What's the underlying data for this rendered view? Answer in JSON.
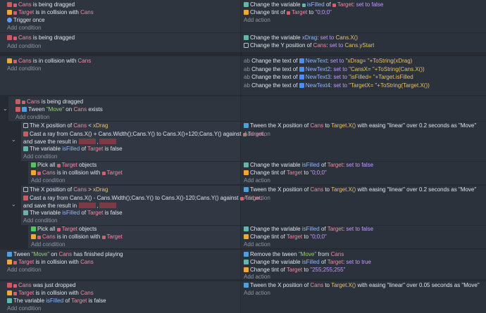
{
  "add_condition": "Add condition",
  "add_action": "Add action",
  "events": [
    {
      "conditions": [
        {
          "obj": "Cans",
          "text": "is being dragged"
        },
        {
          "obj": "Target",
          "text": "is in collision with",
          "obj2": "Cans"
        },
        {
          "text": "Trigger once"
        }
      ],
      "actions": [
        {
          "text": "Change the variable",
          "var": "isFilled",
          "of": "of",
          "obj": "Target",
          "value": "set to false"
        },
        {
          "text": "Change tint of",
          "obj": "Target",
          "to": "to",
          "value": "\"0;0;0\""
        }
      ]
    },
    {
      "conditions": [
        {
          "obj": "Cans",
          "text": "is being dragged"
        }
      ],
      "actions": [
        {
          "text": "Change the variable",
          "var": "xDrag",
          "value": "set to",
          "expr": "Cans.X()"
        },
        {
          "text": "Change the Y position of",
          "obj": "Cans",
          "value": "set to",
          "expr": "Cans.yStart"
        }
      ]
    },
    {
      "conditions": [
        {
          "obj": "Cans",
          "text": "is in collision with",
          "obj2": "Cans"
        }
      ],
      "actions": [
        {
          "text": "Change the text of",
          "obj": "NewText",
          "value": "set to",
          "expr": "\"xDrag= \"+ToString(xDrag)"
        },
        {
          "text": "Change the text of",
          "obj": "NewText2",
          "value": "set to",
          "expr": "\"CansX= \"+ToString(Cans.X())"
        },
        {
          "text": "Change the text of",
          "obj": "NewText3",
          "value": "set to",
          "expr": "\"isFilled= \"+Target.isFilled"
        },
        {
          "text": "Change the text of",
          "obj": "NewText4",
          "value": "set to",
          "expr": "\"TargetX= \"+ToString(Target.X())"
        }
      ]
    },
    {
      "conditions": [
        {
          "obj": "Cans",
          "text": "is being dragged"
        },
        {
          "pre": "Tween",
          "q": "\"Move\"",
          "mid": "on",
          "obj": "Cans",
          "text": "exists"
        }
      ]
    },
    {
      "conditions": [
        {
          "pre": "The X position of",
          "obj": "Cans",
          "op": "<",
          "val": "xDrag"
        },
        {
          "text": "Cast a ray from Cans.X() + Cans.Width();Cans.Y() to Cans.X()+120;Cans.Y() against",
          "obj": "Target,"
        },
        {
          "text": "and save the result in"
        },
        {
          "pre": "The variable",
          "var": "isFilled",
          "mid": "of",
          "obj": "Target",
          "val": "is false"
        }
      ],
      "actions": [
        {
          "text": "Tween the X position of",
          "obj": "Cans",
          "value": "to",
          "expr": "Target.X()",
          "rest": "with easing \"linear\" over 0.2 seconds as \"Move\""
        }
      ]
    },
    {
      "conditions": [
        {
          "text": "Pick all",
          "obj": "Target",
          "val": "objects"
        },
        {
          "obj": "Cans",
          "text": "is in collision with",
          "obj2": "Target"
        }
      ],
      "actions": [
        {
          "text": "Change the variable",
          "var": "isFilled",
          "of": "of",
          "obj": "Target",
          "value": "set to false"
        },
        {
          "text": "Change tint of",
          "obj": "Target",
          "to": "to",
          "value": "\"0;0;0\""
        }
      ]
    },
    {
      "conditions": [
        {
          "pre": "The X position of",
          "obj": "Cans",
          "op": ">",
          "val": "xDrag"
        },
        {
          "text": "Cast a ray from Cans.X() - Cans.Width();Cans.Y() to Cans.X()-120;Cans.Y() against",
          "obj": "Target,"
        },
        {
          "text": "and save the result in"
        },
        {
          "pre": "The variable",
          "var": "isFilled",
          "mid": "of",
          "obj": "Target",
          "val": "is false"
        }
      ],
      "actions": [
        {
          "text": "Tween the X position of",
          "obj": "Cans",
          "value": "to",
          "expr": "Target.X()",
          "rest": "with easing \"linear\" over 0.2 seconds as \"Move\""
        }
      ]
    },
    {
      "conditions": [
        {
          "text": "Pick all",
          "obj": "Target",
          "val": "objects"
        },
        {
          "obj": "Cans",
          "text": "is in collision with",
          "obj2": "Target"
        }
      ],
      "actions": [
        {
          "text": "Change the variable",
          "var": "isFilled",
          "of": "of",
          "obj": "Target",
          "value": "set to false"
        },
        {
          "text": "Change tint of",
          "obj": "Target",
          "to": "to",
          "value": "\"0;0;0\""
        }
      ]
    },
    {
      "conditions": [
        {
          "pre": "Tween",
          "q": "\"Move\"",
          "mid": "on",
          "obj": "Cans",
          "text": "has finished playing"
        },
        {
          "obj": "Target",
          "text": "is in collision with",
          "obj2": "Cans"
        }
      ],
      "actions": [
        {
          "text": "Remove the tween",
          "q": "\"Move\"",
          "mid": "from",
          "obj": "Cans"
        },
        {
          "text": "Change the variable",
          "var": "isFilled",
          "of": "of",
          "obj": "Target",
          "value": "set to true"
        },
        {
          "text": "Change tint of",
          "obj": "Target",
          "to": "to",
          "value": "\"255;255;255\""
        }
      ]
    },
    {
      "conditions": [
        {
          "obj": "Cans",
          "text": "was just dropped"
        },
        {
          "obj": "Target",
          "text": "is in collision with",
          "obj2": "Cans"
        },
        {
          "pre": "The variable",
          "var": "isFilled",
          "mid": "of",
          "obj": "Target",
          "val": "is false"
        }
      ],
      "actions": [
        {
          "text": "Tween the X position of",
          "obj": "Cans",
          "value": "to",
          "expr": "Target.X()",
          "rest": "with easing \"linear\" over 0.05 seconds as \"Move\""
        }
      ]
    }
  ]
}
